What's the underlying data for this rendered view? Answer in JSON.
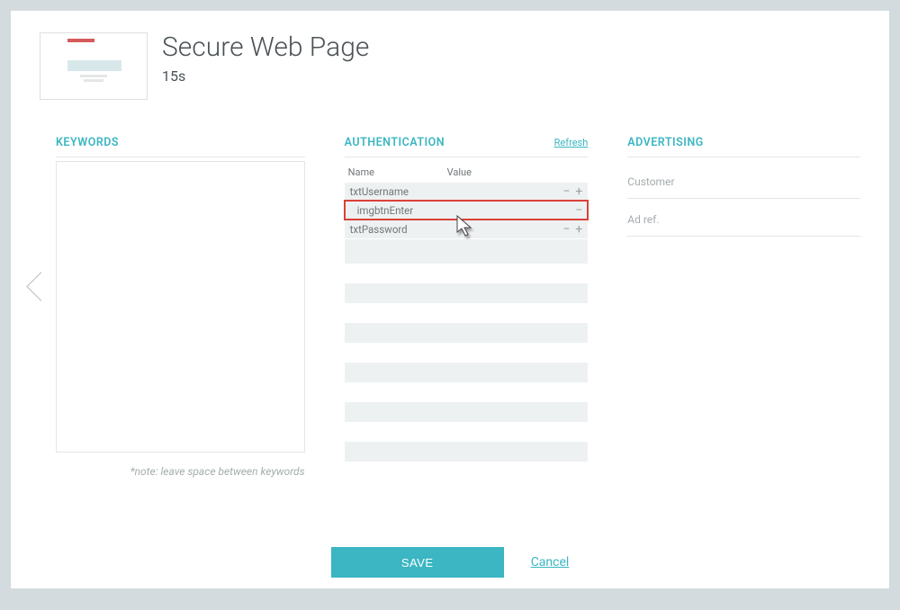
{
  "header": {
    "title": "Secure Web Page",
    "duration": "15s"
  },
  "keywords": {
    "title": "KEYWORDS",
    "note": "*note: leave space between keywords"
  },
  "auth": {
    "title": "AUTHENTICATION",
    "refresh": "Refresh",
    "columns": {
      "name": "Name",
      "value": "Value"
    },
    "rows": [
      {
        "name": "txtUsername",
        "value": "",
        "sub": false,
        "highlight": false,
        "has_plus": true
      },
      {
        "name": "imgbtnEnter",
        "value": "",
        "sub": true,
        "highlight": true,
        "has_plus": false
      },
      {
        "name": "txtPassword",
        "value": "",
        "sub": false,
        "highlight": false,
        "has_plus": true
      }
    ]
  },
  "advertising": {
    "title": "ADVERTISING",
    "fields": [
      {
        "label": "Customer"
      },
      {
        "label": "Ad ref."
      }
    ]
  },
  "footer": {
    "save": "SAVE",
    "cancel": "Cancel"
  },
  "icons": {
    "minus": "−",
    "plus": "+"
  }
}
